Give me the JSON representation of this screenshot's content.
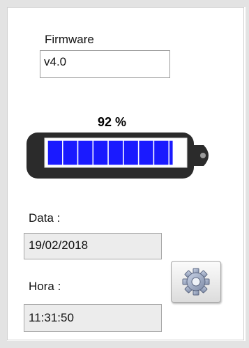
{
  "firmware": {
    "label": "Firmware",
    "value": "v4.0"
  },
  "battery": {
    "percent_text": "92 %",
    "level_percent": 92,
    "segments_total": 9,
    "fill_color": "#1a1aff",
    "case_color": "#2b2b2b"
  },
  "date": {
    "label": "Data :",
    "value": "19/02/2018"
  },
  "time": {
    "label": "Hora :",
    "value": "11:31:50"
  },
  "settings_button": {
    "icon": "gear-icon"
  }
}
